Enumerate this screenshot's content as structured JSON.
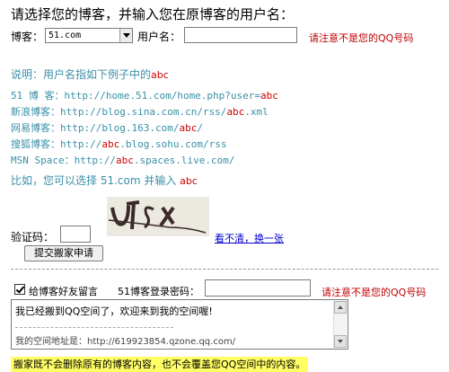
{
  "title": "请选择您的博客，并输入您在原博客的用户名：",
  "form": {
    "blog_label": "博客：",
    "blog_selected": "51.com",
    "username_label": "用户名：",
    "username_value": "",
    "warning": "请注意不是您的QQ号码"
  },
  "explain": {
    "header_prefix": "说明：用户名指如下例子中的",
    "keyword": "abc",
    "examples": [
      {
        "prefix": "51 博 客：http://home.51.com/home.php?user=",
        "hl": "abc",
        "suffix": ""
      },
      {
        "prefix": "新浪博客：http://blog.sina.com.cn/rss/",
        "hl": "abc",
        "suffix": ".xml"
      },
      {
        "prefix": "网易博客：http://blog.163.com/",
        "hl": "abc",
        "suffix": "/"
      },
      {
        "prefix": "搜狐博客：http://",
        "hl": "abc",
        "suffix": ".blog.sohu.com/rss"
      },
      {
        "prefix": "MSN Space：http://",
        "hl": "abc",
        "suffix": ".spaces.live.com/"
      }
    ],
    "example_line_prefix": "比如，您可以选择 51.com 并输入",
    "example_line_value": "abc"
  },
  "captcha": {
    "label": "验证码：",
    "value": "",
    "refresh_link": "看不清，换一张"
  },
  "submit_label": "提交搬家申请",
  "message": {
    "checkbox_label": "给博客好友留言",
    "checked": true,
    "password_label": "51博客登录密码：",
    "password_value": "",
    "warning": "请注意不是您的QQ号码",
    "line1": "我已经搬到QQ空间了，欢迎来到我的空间喔!",
    "line2": "我的空间地址是：http://619923854.qzone.qq.com/"
  },
  "notice": "搬家既不会删除原有的博客内容，也不会覆盖您QQ空间中的内容。",
  "colors": {
    "teal": "#3a8fa8",
    "red": "#c00000",
    "notice_bg": "#ffff66"
  }
}
